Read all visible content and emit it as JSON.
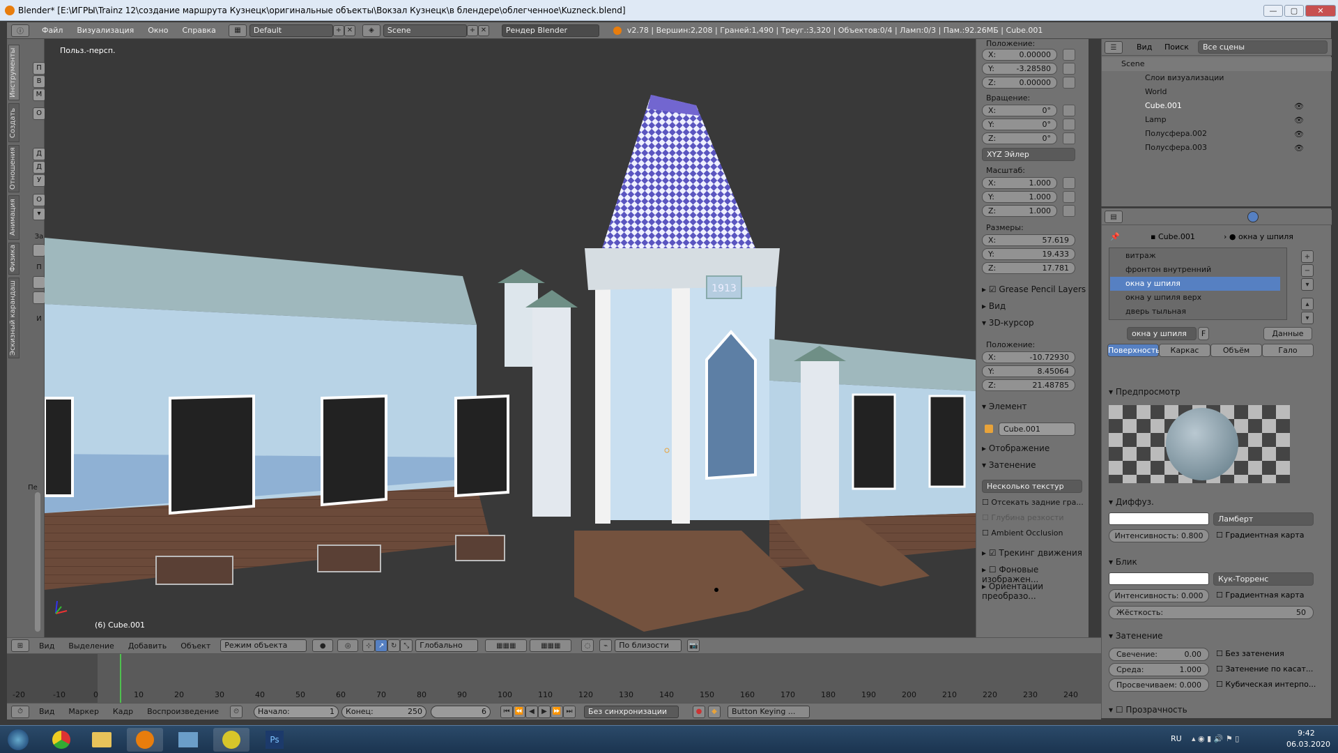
{
  "title": "Blender* [E:\\ИГРЫ\\Trainz 12\\создание маршрута Кузнецк\\оригинальные объекты\\Вокзал Кузнецк\\в блендере\\облегченное\\Kuzneck.blend]",
  "menu": [
    "Файл",
    "Визуализация",
    "Окно",
    "Справка"
  ],
  "layout": "Default",
  "scene": "Scene",
  "engine": "Рендер Blender",
  "stats": "v2.78 | Вершин:2,208 | Граней:1,490 | Треуг.:3,320 | Объектов:0/4 | Ламп:0/3 | Пам.:92.26МБ | Cube.001",
  "left_tabs": [
    "Инструменты",
    "Создать",
    "Отношения",
    "Анимация",
    "Физика",
    "Эскизный карандаш"
  ],
  "left_btns": [
    "П",
    "В",
    "М",
    "О",
    "Д",
    "Д",
    "У",
    "О",
    "За",
    "П",
    "И",
    "Пе"
  ],
  "viewport": {
    "label": "Польз.-персп.",
    "object_label": "(6) Cube.001",
    "plaque": "1913"
  },
  "npanel": {
    "pos_label": "Положение:",
    "location": [
      {
        "a": "X:",
        "v": "0.00000"
      },
      {
        "a": "Y:",
        "v": "-3.28580"
      },
      {
        "a": "Z:",
        "v": "0.00000"
      }
    ],
    "rot_label": "Вращение:",
    "rotation": [
      {
        "a": "X:",
        "v": "0°"
      },
      {
        "a": "Y:",
        "v": "0°"
      },
      {
        "a": "Z:",
        "v": "0°"
      }
    ],
    "rot_mode": "XYZ Эйлер",
    "scale_label": "Масштаб:",
    "scale": [
      {
        "a": "X:",
        "v": "1.000"
      },
      {
        "a": "Y:",
        "v": "1.000"
      },
      {
        "a": "Z:",
        "v": "1.000"
      }
    ],
    "dim_label": "Размеры:",
    "dimensions": [
      {
        "a": "X:",
        "v": "57.619"
      },
      {
        "a": "Y:",
        "v": "19.433"
      },
      {
        "a": "Z:",
        "v": "17.781"
      }
    ],
    "grease": "Grease Pencil Layers",
    "view": "Вид",
    "cursor": "3D-курсор",
    "cursor_pos": "Положение:",
    "cursor_vals": [
      {
        "a": "X:",
        "v": "-10.72930"
      },
      {
        "a": "Y:",
        "v": "8.45064"
      },
      {
        "a": "Z:",
        "v": "21.48785"
      }
    ],
    "item": "Элемент",
    "item_name": "Cube.001",
    "display": "Отображение",
    "shading": "Затенение",
    "shading_mode": "Несколько текстур",
    "backface": "Отсекать задние гра...",
    "dof": "Глубина резкости",
    "ao": "Ambient Occlusion",
    "motion": "Трекинг движения",
    "bg": "Фоновые изображен...",
    "orient": "Ориентации преобразо..."
  },
  "outliner": {
    "menu": [
      "Вид",
      "Поиск"
    ],
    "filter": "Все сцены",
    "rows": [
      "Scene",
      "Слои визуализации",
      "World",
      "Cube.001",
      "Lamp",
      "Полусфера.002",
      "Полусфера.003"
    ]
  },
  "props": {
    "crumb_obj": "Cube.001",
    "crumb_mat": "окна у шпиля",
    "materials": [
      "витраж",
      "фронтон внутренний",
      "окна у шпиля",
      "окна у шпиля верх",
      "дверь тыльная"
    ],
    "mat_field": "окна у шпиля",
    "mat_f": "F",
    "data": "Данные",
    "tabs": [
      "Поверхность",
      "Каркас",
      "Объём",
      "Гало"
    ],
    "preview": "Предпросмотр",
    "diffuse": "Диффуз.",
    "diffuse_shader": "Ламберт",
    "diffuse_int": "Интенсивность: 0.800",
    "ramp": "Градиентная карта",
    "spec": "Блик",
    "spec_shader": "Кук-Торренс",
    "spec_int": "Интенсивность: 0.000",
    "ramp2": "Градиентная карта",
    "hardness_label": "Жёсткость:",
    "hardness": "50",
    "shading": "Затенение",
    "emit": "Свечение:",
    "emit_v": "0.00",
    "ambient": "Среда:",
    "ambient_v": "1.000",
    "translucency": "Просвечиваем: 0.000",
    "shadeless": "Без затенения",
    "tangent": "Затенение по касат...",
    "cubic": "Кубическая интерпо...",
    "transparency": "Прозрачность"
  },
  "bar3d": [
    "Вид",
    "Выделение",
    "Добавить",
    "Объект"
  ],
  "mode": "Режим объекта",
  "orientation": "Глобально",
  "snap": "По близости",
  "timeline": {
    "ticks": [
      "-20",
      "-10",
      "0",
      "10",
      "20",
      "30",
      "40",
      "50",
      "60",
      "70",
      "80",
      "90",
      "100",
      "110",
      "120",
      "130",
      "140",
      "150",
      "160",
      "170",
      "180",
      "190",
      "200",
      "210",
      "220",
      "230",
      "240"
    ],
    "current_frame": 6
  },
  "tlbar": [
    "Вид",
    "Маркер",
    "Кадр",
    "Воспроизведение"
  ],
  "start_label": "Начало:",
  "start": "1",
  "end_label": "Конец:",
  "end": "250",
  "frame": "6",
  "sync": "Без синхронизации",
  "keying": "Button Keying ...",
  "tray": {
    "lang": "RU",
    "time": "9:42",
    "date": "06.03.2020"
  },
  "colors": {
    "viewport_bg": "#393939",
    "panel": "#727272",
    "selected": "#5680c2",
    "building": "#b8d3e6",
    "roof": "#8aa7ad",
    "spire_check": "#5a55c0"
  }
}
